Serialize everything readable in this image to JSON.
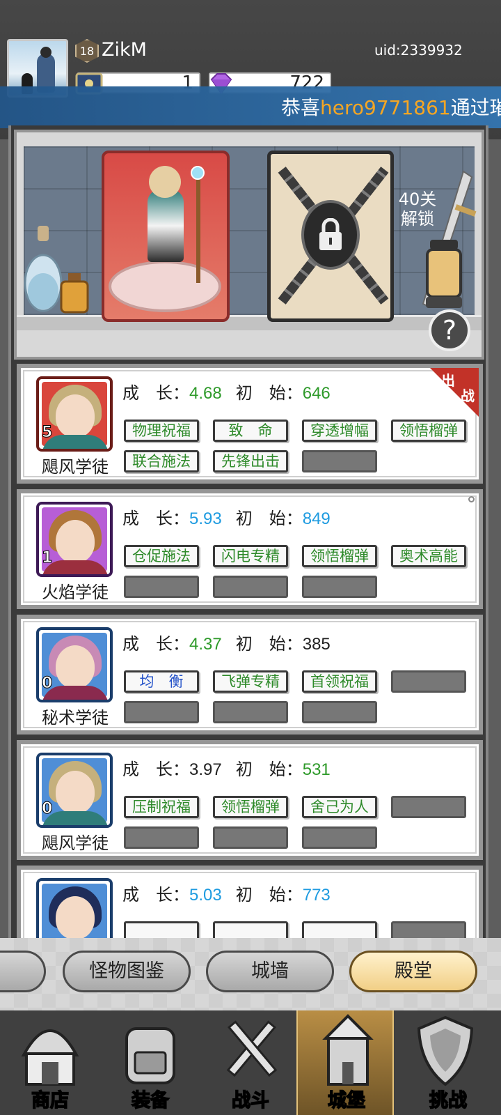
{
  "header": {
    "level": "18",
    "username": "ZikM",
    "uid": "uid:2339932",
    "resources": [
      {
        "icon": "book-icon",
        "value": "1"
      },
      {
        "icon": "gem-icon",
        "value": "722"
      }
    ]
  },
  "banner": {
    "prefix": "恭喜",
    "player": "hero9771861",
    "suffix": "通过璀"
  },
  "showcase": {
    "unlock_text_line1": "40关",
    "unlock_text_line2": "解锁",
    "help_label": "?"
  },
  "heroes": [
    {
      "name": "飓风学徒",
      "stars": "5",
      "frame_color": "#d23b32",
      "growth_label": "成　长：",
      "growth": "4.68",
      "init_label": "初　始：",
      "init": "646",
      "deployed": true,
      "skills": [
        "物理祝福",
        "致　命",
        "穿透增幅",
        "领悟榴弹",
        "联合施法",
        "先锋出击",
        ""
      ]
    },
    {
      "name": "火焰学徒",
      "stars": "1",
      "frame_color": "#8b3bb8",
      "growth_label": "成　长：",
      "growth": "5.93",
      "init_label": "初　始：",
      "init": "849",
      "deployed": false,
      "skills": [
        "仓促施法",
        "闪电专精",
        "领悟榴弹",
        "奥术高能",
        "",
        "",
        ""
      ]
    },
    {
      "name": "秘术学徒",
      "stars": "0",
      "frame_color": "#2a6cc0",
      "growth_label": "成　长：",
      "growth": "4.37",
      "init_label": "初　始：",
      "init": "385",
      "deployed": false,
      "skills": [
        "均　衡",
        "飞弹专精",
        "首领祝福",
        "",
        "",
        "",
        ""
      ]
    },
    {
      "name": "飓风学徒",
      "stars": "0",
      "frame_color": "#2a6cc0",
      "growth_label": "成　长：",
      "growth": "3.97",
      "init_label": "初　始：",
      "init": "531",
      "deployed": false,
      "skills": [
        "压制祝福",
        "领悟榴弹",
        "舍己为人",
        "",
        "",
        "",
        ""
      ]
    },
    {
      "name": "",
      "stars": "",
      "frame_color": "#2a6cc0",
      "growth_label": "成　长：",
      "growth": "5.03",
      "init_label": "初　始：",
      "init": "773",
      "deployed": false,
      "skills": []
    }
  ],
  "deploy_badge": {
    "line1": "出",
    "line2": "战"
  },
  "subtabs": [
    "怪物图鉴",
    "城墙",
    "殿堂"
  ],
  "nav": [
    {
      "label": "商店",
      "icon": "shop-icon"
    },
    {
      "label": "装备",
      "icon": "backpack-icon"
    },
    {
      "label": "战斗",
      "icon": "crossed-swords-icon"
    },
    {
      "label": "城堡",
      "icon": "castle-icon"
    },
    {
      "label": "挑战",
      "icon": "shield-icon"
    }
  ],
  "colors": {
    "growth_green": "#2e9a2a",
    "growth_blue": "#1e9be0",
    "active_tab": "#f1cf86"
  }
}
